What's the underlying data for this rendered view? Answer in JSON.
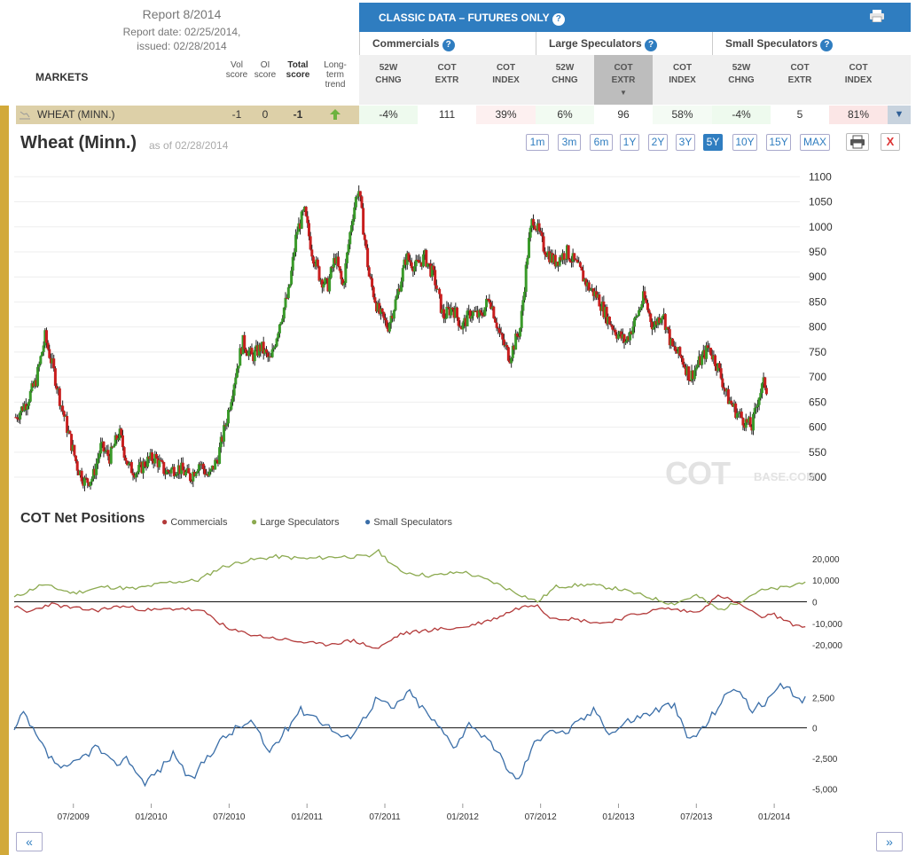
{
  "report": {
    "title": "Report 8/2014",
    "date_line1": "Report date: 02/25/2014,",
    "date_line2": "issued: 02/28/2014"
  },
  "markets_label": "MARKETS",
  "score_headers": {
    "vol": [
      "Vol",
      "score"
    ],
    "oi": [
      "OI",
      "score"
    ],
    "total": [
      "Total",
      "score"
    ],
    "trend": [
      "Long-",
      "term",
      "trend"
    ]
  },
  "classic": {
    "title": "CLASSIC DATA – FUTURES ONLY"
  },
  "groups": [
    "Commercials",
    "Large Speculators",
    "Small Speculators"
  ],
  "columns": [
    [
      "52W",
      "CHNG"
    ],
    [
      "COT",
      "EXTR"
    ],
    [
      "COT",
      "INDEX"
    ]
  ],
  "wheat_row": {
    "market": "WHEAT (MINN.)",
    "vol": "-1",
    "oi": "0",
    "total": "-1",
    "values": [
      "-4%",
      "111",
      "39%",
      "6%",
      "96",
      "58%",
      "-4%",
      "5",
      "81%"
    ]
  },
  "chart": {
    "title": "Wheat (Minn.)",
    "asof": "as of 02/28/2014",
    "ranges": [
      "1m",
      "3m",
      "6m",
      "1Y",
      "2Y",
      "3Y",
      "5Y",
      "10Y",
      "15Y",
      "MAX"
    ],
    "active_range": "5Y",
    "watermark": "COTBASE.COM"
  },
  "cot": {
    "title": "COT Net Positions",
    "legend": [
      "Commercials",
      "Large Speculators",
      "Small Speculators"
    ]
  },
  "colors": {
    "commercials": "#b33a3a",
    "large": "#8caa50",
    "small": "#3a6ea8",
    "up": "#3a9a2a",
    "down": "#c81e1e",
    "accent": "#2f7dc0"
  },
  "chart_data": [
    {
      "type": "candlestick",
      "title": "Wheat (Minn.)",
      "ylim": [
        470,
        1120
      ],
      "yticks": [
        500,
        550,
        600,
        650,
        700,
        750,
        800,
        850,
        900,
        950,
        1000,
        1050,
        1100
      ],
      "x_labels": [
        "07/2009",
        "01/2010",
        "07/2010",
        "01/2011",
        "07/2011",
        "01/2012",
        "07/2012",
        "01/2013",
        "07/2013",
        "01/2014"
      ],
      "x_range": [
        2009.12,
        2014.21
      ],
      "close_points": [
        [
          2009.13,
          620
        ],
        [
          2009.2,
          650
        ],
        [
          2009.26,
          690
        ],
        [
          2009.32,
          780
        ],
        [
          2009.37,
          720
        ],
        [
          2009.42,
          650
        ],
        [
          2009.47,
          590
        ],
        [
          2009.53,
          520
        ],
        [
          2009.58,
          490
        ],
        [
          2009.63,
          500
        ],
        [
          2009.68,
          560
        ],
        [
          2009.74,
          540
        ],
        [
          2009.8,
          590
        ],
        [
          2009.86,
          520
        ],
        [
          2009.92,
          510
        ],
        [
          2009.97,
          530
        ],
        [
          2010.03,
          540
        ],
        [
          2010.1,
          510
        ],
        [
          2010.18,
          520
        ],
        [
          2010.26,
          500
        ],
        [
          2010.32,
          530
        ],
        [
          2010.38,
          500
        ],
        [
          2010.44,
          540
        ],
        [
          2010.5,
          620
        ],
        [
          2010.55,
          700
        ],
        [
          2010.6,
          770
        ],
        [
          2010.66,
          740
        ],
        [
          2010.72,
          760
        ],
        [
          2010.78,
          730
        ],
        [
          2010.84,
          810
        ],
        [
          2010.9,
          870
        ],
        [
          2010.95,
          990
        ],
        [
          2011.0,
          1030
        ],
        [
          2011.05,
          950
        ],
        [
          2011.1,
          900
        ],
        [
          2011.15,
          880
        ],
        [
          2011.2,
          940
        ],
        [
          2011.25,
          880
        ],
        [
          2011.31,
          1020
        ],
        [
          2011.35,
          1080
        ],
        [
          2011.42,
          900
        ],
        [
          2011.48,
          830
        ],
        [
          2011.54,
          800
        ],
        [
          2011.6,
          860
        ],
        [
          2011.66,
          940
        ],
        [
          2011.72,
          920
        ],
        [
          2011.78,
          940
        ],
        [
          2011.84,
          900
        ],
        [
          2011.9,
          820
        ],
        [
          2011.96,
          840
        ],
        [
          2012.02,
          800
        ],
        [
          2012.08,
          830
        ],
        [
          2012.14,
          820
        ],
        [
          2012.2,
          860
        ],
        [
          2012.27,
          780
        ],
        [
          2012.33,
          740
        ],
        [
          2012.4,
          800
        ],
        [
          2012.45,
          960
        ],
        [
          2012.48,
          1020
        ],
        [
          2012.55,
          960
        ],
        [
          2012.62,
          930
        ],
        [
          2012.7,
          950
        ],
        [
          2012.77,
          920
        ],
        [
          2012.84,
          880
        ],
        [
          2012.9,
          860
        ],
        [
          2012.96,
          820
        ],
        [
          2013.02,
          790
        ],
        [
          2013.08,
          770
        ],
        [
          2013.14,
          810
        ],
        [
          2013.2,
          860
        ],
        [
          2013.26,
          800
        ],
        [
          2013.32,
          830
        ],
        [
          2013.38,
          760
        ],
        [
          2013.44,
          740
        ],
        [
          2013.5,
          700
        ],
        [
          2013.56,
          730
        ],
        [
          2013.62,
          760
        ],
        [
          2013.68,
          720
        ],
        [
          2013.74,
          660
        ],
        [
          2013.8,
          630
        ],
        [
          2013.86,
          610
        ],
        [
          2013.9,
          600
        ],
        [
          2013.94,
          660
        ],
        [
          2013.98,
          690
        ],
        [
          2014.0,
          670
        ]
      ],
      "up_color": "#3a9a2a",
      "down_color": "#c81e1e"
    },
    {
      "type": "line",
      "title": "COT Net Positions",
      "ylim": [
        -27000,
        27000
      ],
      "yticks": [
        20000,
        10000,
        0,
        -10000,
        -20000
      ],
      "ytick_labels": [
        "20,000",
        "10,000",
        "0",
        "-10,000",
        "-20,000"
      ],
      "series": [
        {
          "name": "Commercials",
          "color": "#b33a3a",
          "values": [
            [
              2009.12,
              -2000
            ],
            [
              2009.2,
              -5000
            ],
            [
              2009.35,
              -1000
            ],
            [
              2009.5,
              -3000
            ],
            [
              2009.65,
              -4000
            ],
            [
              2009.8,
              -2000
            ],
            [
              2010.0,
              -4000
            ],
            [
              2010.2,
              -3000
            ],
            [
              2010.35,
              -5000
            ],
            [
              2010.5,
              -13000
            ],
            [
              2010.7,
              -16000
            ],
            [
              2010.9,
              -18000
            ],
            [
              2011.1,
              -20000
            ],
            [
              2011.3,
              -18000
            ],
            [
              2011.45,
              -22000
            ],
            [
              2011.6,
              -15000
            ],
            [
              2011.8,
              -13000
            ],
            [
              2012.0,
              -12000
            ],
            [
              2012.2,
              -8000
            ],
            [
              2012.35,
              -3000
            ],
            [
              2012.48,
              -1000
            ],
            [
              2012.55,
              -7000
            ],
            [
              2012.7,
              -8000
            ],
            [
              2012.9,
              -10000
            ],
            [
              2013.1,
              -6000
            ],
            [
              2013.3,
              -3000
            ],
            [
              2013.5,
              -5000
            ],
            [
              2013.65,
              3000
            ],
            [
              2013.8,
              -2000
            ],
            [
              2013.9,
              -7000
            ],
            [
              2014.0,
              -6000
            ],
            [
              2014.1,
              -10000
            ],
            [
              2014.21,
              -12000
            ]
          ]
        },
        {
          "name": "Large Speculators",
          "color": "#8caa50",
          "values": [
            [
              2009.12,
              2000
            ],
            [
              2009.3,
              8000
            ],
            [
              2009.5,
              4000
            ],
            [
              2009.7,
              7000
            ],
            [
              2009.9,
              6000
            ],
            [
              2010.1,
              9000
            ],
            [
              2010.3,
              10000
            ],
            [
              2010.45,
              16000
            ],
            [
              2010.6,
              19000
            ],
            [
              2010.8,
              21000
            ],
            [
              2011.0,
              20000
            ],
            [
              2011.2,
              21000
            ],
            [
              2011.4,
              21000
            ],
            [
              2011.45,
              24000
            ],
            [
              2011.6,
              14000
            ],
            [
              2011.8,
              12000
            ],
            [
              2012.0,
              14000
            ],
            [
              2012.2,
              9000
            ],
            [
              2012.35,
              4000
            ],
            [
              2012.48,
              0
            ],
            [
              2012.6,
              7000
            ],
            [
              2012.8,
              8000
            ],
            [
              2013.0,
              6000
            ],
            [
              2013.2,
              2000
            ],
            [
              2013.35,
              -1000
            ],
            [
              2013.5,
              3000
            ],
            [
              2013.65,
              -4000
            ],
            [
              2013.8,
              1000
            ],
            [
              2013.9,
              5000
            ],
            [
              2014.1,
              7000
            ],
            [
              2014.21,
              10000
            ]
          ]
        },
        {
          "name": "Small Speculators",
          "color": "#3a6ea8",
          "ylim": [
            -6000,
            4200
          ],
          "yticks": [
            2500,
            0,
            -2500,
            -5000
          ],
          "ytick_labels": [
            "2,500",
            "0",
            "-2,500",
            "-5,000"
          ],
          "values": [
            [
              2009.12,
              -300
            ],
            [
              2009.18,
              1200
            ],
            [
              2009.25,
              -500
            ],
            [
              2009.35,
              -2500
            ],
            [
              2009.45,
              -3500
            ],
            [
              2009.55,
              -2500
            ],
            [
              2009.65,
              -1500
            ],
            [
              2009.75,
              -3000
            ],
            [
              2009.85,
              -2500
            ],
            [
              2009.95,
              -4500
            ],
            [
              2010.05,
              -3500
            ],
            [
              2010.15,
              -2000
            ],
            [
              2010.25,
              -4500
            ],
            [
              2010.35,
              -2500
            ],
            [
              2010.45,
              -1000
            ],
            [
              2010.55,
              0
            ],
            [
              2010.65,
              500
            ],
            [
              2010.75,
              -2000
            ],
            [
              2010.85,
              -500
            ],
            [
              2010.95,
              1500
            ],
            [
              2011.05,
              1000
            ],
            [
              2011.15,
              0
            ],
            [
              2011.25,
              -1000
            ],
            [
              2011.35,
              500
            ],
            [
              2011.45,
              2500
            ],
            [
              2011.55,
              1500
            ],
            [
              2011.65,
              3000
            ],
            [
              2011.75,
              1500
            ],
            [
              2011.85,
              0
            ],
            [
              2011.95,
              -1500
            ],
            [
              2012.05,
              500
            ],
            [
              2012.15,
              -1000
            ],
            [
              2012.25,
              -2500
            ],
            [
              2012.35,
              -4500
            ],
            [
              2012.45,
              -1500
            ],
            [
              2012.55,
              0
            ],
            [
              2012.65,
              -500
            ],
            [
              2012.75,
              500
            ],
            [
              2012.85,
              1500
            ],
            [
              2012.95,
              -500
            ],
            [
              2013.05,
              500
            ],
            [
              2013.15,
              1000
            ],
            [
              2013.25,
              1500
            ],
            [
              2013.35,
              2000
            ],
            [
              2013.45,
              -1000
            ],
            [
              2013.55,
              0
            ],
            [
              2013.65,
              2000
            ],
            [
              2013.75,
              3500
            ],
            [
              2013.85,
              1500
            ],
            [
              2013.95,
              2000
            ],
            [
              2014.05,
              3500
            ],
            [
              2014.15,
              2500
            ],
            [
              2014.21,
              2200
            ]
          ]
        }
      ],
      "x_labels": [
        "07/2009",
        "01/2010",
        "07/2010",
        "01/2011",
        "07/2011",
        "01/2012",
        "07/2012",
        "01/2013",
        "07/2013",
        "01/2014"
      ]
    }
  ]
}
